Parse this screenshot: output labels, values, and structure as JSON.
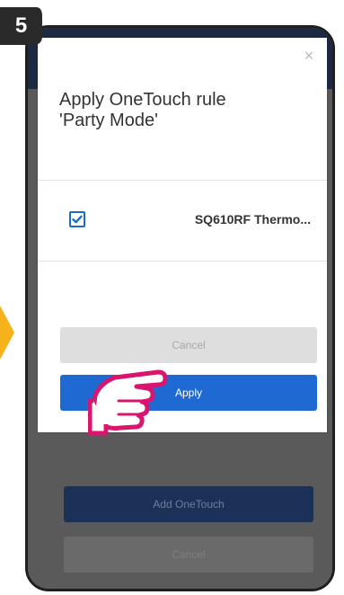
{
  "step": {
    "number": "5"
  },
  "background_screen": {
    "add_button_label": "Add OneTouch",
    "cancel_button_label": "Cancel"
  },
  "dialog": {
    "close_symbol": "×",
    "title": "Apply OneTouch rule 'Party Mode'",
    "device": {
      "name": "SQ610RF Thermo...",
      "checked": true
    },
    "cancel_label": "Cancel",
    "apply_label": "Apply"
  },
  "icons": {
    "close": "close-icon",
    "checkbox": "checkmark-icon",
    "hand": "pointing-hand-icon",
    "arrow": "arrow-icon"
  },
  "colors": {
    "accent": "#1f6ad2",
    "step_badge": "#2a2a2a",
    "arrow": "#f6b21a",
    "hand_outline": "#d9156e"
  }
}
